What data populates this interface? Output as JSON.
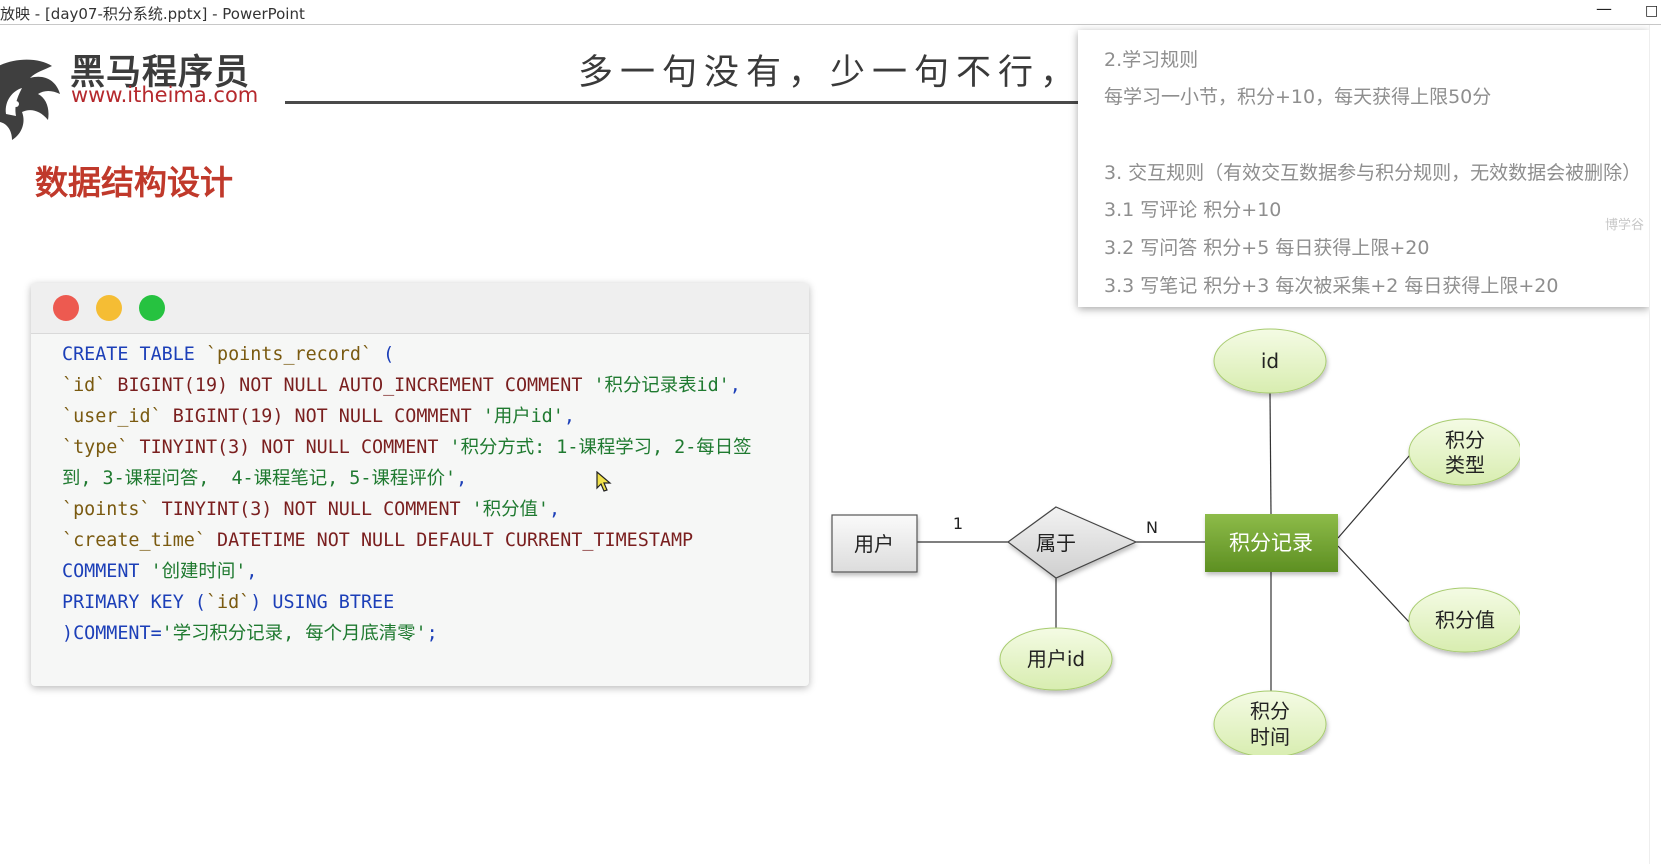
{
  "window": {
    "title": "放映 - [day07-积分系统.pptx] - PowerPoint",
    "minimize_glyph": "—",
    "maximize_glyph": "□"
  },
  "slide": {
    "logo": {
      "name": "黑马程序员",
      "url": "www.itheima.com"
    },
    "slogan": "多一句没有，少一句不行，用",
    "section_title": "数据结构设计",
    "code_lines": [
      [
        "CREATE TABLE ",
        "`points_record`",
        " ("
      ],
      [
        "`id`",
        " BIGINT(19) NOT NULL AUTO_INCREMENT COMMENT ",
        "'积分记录表id'",
        ","
      ],
      [
        "`user_id`",
        " BIGINT(19) NOT NULL COMMENT ",
        "'用户id'",
        ","
      ],
      [
        "`type`",
        " TINYINT(3) NOT NULL COMMENT ",
        "'积分方式: 1-课程学习, 2-每日签"
      ],
      [
        "到, 3-课程问答,  4-课程笔记, 5-课程评价'",
        ","
      ],
      [
        "`points`",
        " TINYINT(3) NOT NULL COMMENT ",
        "'积分值'",
        ","
      ],
      [
        "`create_time`",
        " DATETIME NOT NULL DEFAULT CURRENT_TIMESTAMP"
      ],
      [
        "COMMENT ",
        "'创建时间'",
        ","
      ],
      [
        "PRIMARY KEY (",
        "`id`",
        ") USING BTREE"
      ],
      [
        ")COMMENT=",
        "'学习积分记录, 每个月底清零'",
        ";"
      ]
    ],
    "er": {
      "user_entity": "用户",
      "relation": "属于",
      "record_entity": "积分记录",
      "card_user": "1",
      "card_record": "N",
      "attr_user_id": "用户id",
      "attr_id": "id",
      "attr_type": [
        "积分",
        "类型"
      ],
      "attr_value": "积分值",
      "attr_time": [
        "积分",
        "时间"
      ]
    },
    "popup_lines": [
      "2.学习规则",
      "每学习一小节，积分+10，每天获得上限50分",
      "3. 交互规则（有效交互数据参与积分规则，无效数据会被删除）",
      "3.1 写评论 积分+10",
      "3.2 写问答 积分+5 每日获得上限+20",
      "3.3 写笔记 积分+3 每次被采集+2 每日获得上限+20"
    ],
    "watermark": "博学谷"
  }
}
